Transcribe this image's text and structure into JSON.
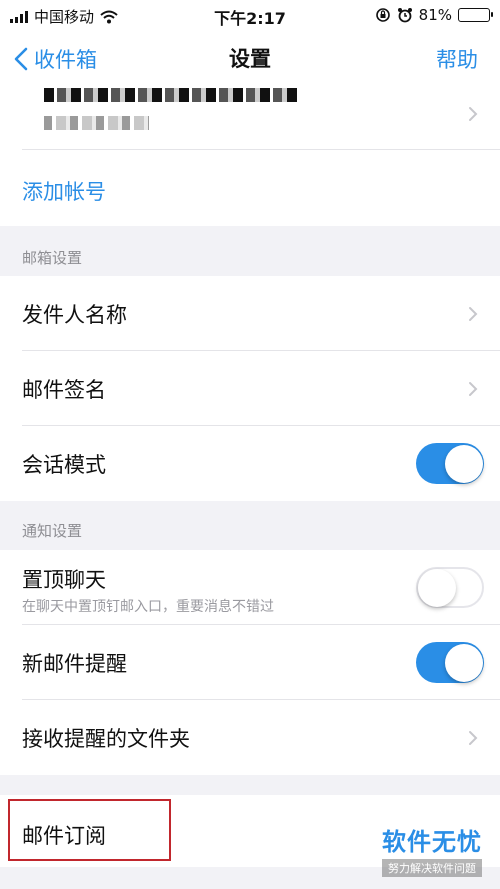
{
  "status_bar": {
    "carrier": "中国移动",
    "time": "下午2:17",
    "battery": "81%",
    "battery_level": 0.81
  },
  "nav": {
    "back_label": "收件箱",
    "title": "设置",
    "help_label": "帮助"
  },
  "account": {
    "add_account_label": "添加帐号"
  },
  "mailbox_settings": {
    "header": "邮箱设置",
    "sender_name": "发件人名称",
    "signature": "邮件签名",
    "conversation_mode": "会话模式",
    "conversation_mode_on": true
  },
  "notification_settings": {
    "header": "通知设置",
    "pin_chat": "置顶聊天",
    "pin_chat_desc": "在聊天中置顶钉邮入口，重要消息不错过",
    "pin_chat_on": false,
    "new_mail_alert": "新邮件提醒",
    "new_mail_alert_on": true,
    "alert_folders": "接收提醒的文件夹"
  },
  "subscription": {
    "label": "邮件订阅"
  },
  "watermark": {
    "main": "软件无忧",
    "sub": "努力解决软件问题"
  },
  "colors": {
    "accent": "#2a8ee6",
    "highlight_border": "#c1272d",
    "background": "#f2f2f6"
  },
  "icons": {
    "wifi": "wifi-icon",
    "alarm": "alarm-icon",
    "rotation_lock": "rotation-lock-icon",
    "back": "chevron-left-icon",
    "disclosure": "chevron-right-icon"
  }
}
